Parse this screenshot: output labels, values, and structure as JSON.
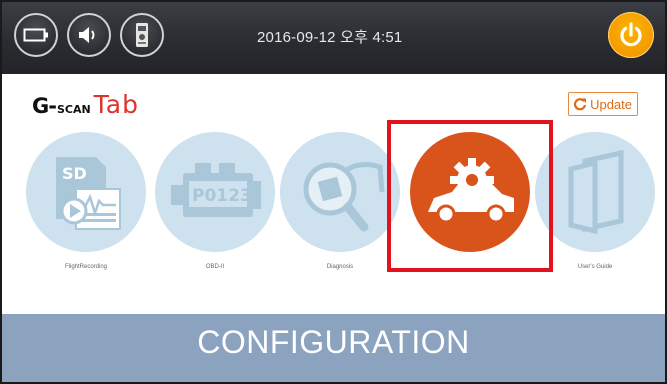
{
  "status_bar": {
    "datetime": "2016-09-12 오후 4:51",
    "buttons": [
      {
        "icon": "battery-icon"
      },
      {
        "icon": "volume-icon"
      },
      {
        "icon": "vci-device-icon"
      }
    ],
    "power_icon": "power-icon"
  },
  "brand": {
    "logo_g": "G-",
    "logo_scan": "scan",
    "logo_tab": "Tab"
  },
  "update": {
    "label": "Update",
    "icon": "refresh-icon"
  },
  "menu": {
    "items": [
      {
        "label": "FlightRecording",
        "icon": "sd-card-recording-icon"
      },
      {
        "label": "OBD-II",
        "icon": "engine-code-icon"
      },
      {
        "label": "Diagnosis",
        "icon": "chip-magnifier-icon"
      },
      {
        "label": "",
        "icon": "car-gear-icon",
        "selected": true
      },
      {
        "label": "User's Guide",
        "icon": "book-icon"
      }
    ]
  },
  "footer": {
    "title": "CONFIGURATION"
  },
  "colors": {
    "accent": "#d9541a",
    "highlight": "#e2131d",
    "footer_bg": "#8ba3bf",
    "icon_bg": "#cde2ee",
    "power": "#f49b00"
  }
}
